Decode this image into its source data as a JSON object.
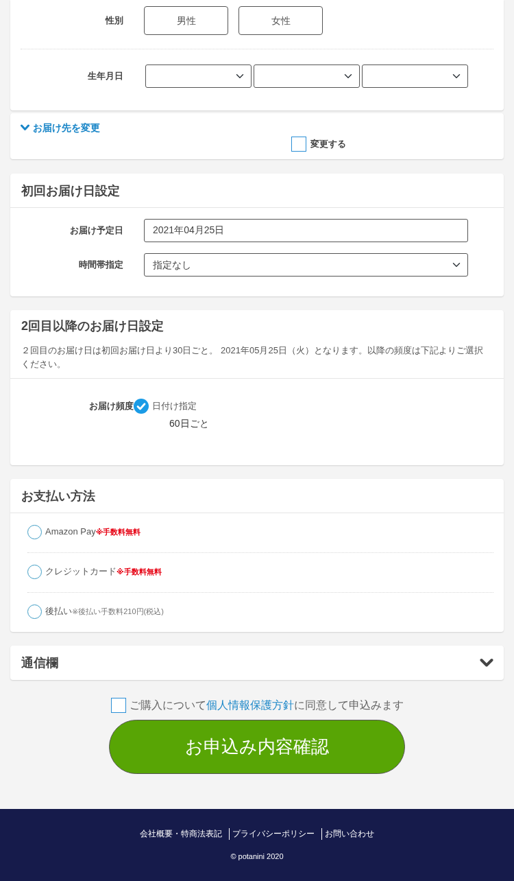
{
  "profile": {
    "fields": [
      {
        "kind": "choice",
        "label": "性別",
        "options": [
          {
            "label": "男性",
            "selected": false
          },
          {
            "label": "女性",
            "selected": false
          }
        ]
      },
      {
        "kind": "date",
        "label": "生年月日"
      }
    ]
  },
  "delivery_address": {
    "toggle_label": "お届け先を変更",
    "expanded": false,
    "checkbox": {
      "label": "変更する",
      "checked": false
    }
  },
  "first_delivery": {
    "title": "初回お届け日設定",
    "fields": [
      {
        "kind": "text",
        "label": "お届け予定日",
        "value": "2021年04月25日"
      },
      {
        "kind": "select",
        "label": "時間帯指定",
        "value": "指定なし"
      }
    ]
  },
  "later_delivery": {
    "title": "2回目以降のお届け日設定",
    "description": "２回目のお届け日は初回お届け日より30日ごと。 2021年05月25日（火）となります。以降の頻度は下記よりご選択ください。",
    "frequency": {
      "label": "お届け頻度",
      "options": [
        {
          "label": "日付け指定",
          "checked": true
        }
      ],
      "value": "60日ごと"
    }
  },
  "payment": {
    "title": "お支払い方法",
    "options": [
      {
        "label": "Amazon Pay",
        "note": "※手数料無料",
        "kind": "highlight",
        "selected": false
      },
      {
        "label": "クレジットカード",
        "note": "※手数料無料",
        "kind": "highlight",
        "selected": false
      },
      {
        "label": "後払い",
        "note": "※後払い手数料210円(税込)",
        "kind": "muted",
        "selected": false
      }
    ]
  },
  "message": {
    "title": "通信欄",
    "expanded": false
  },
  "agreement": {
    "checked": false,
    "text_before": "ご購入について",
    "link": "個人情報保護方針",
    "text_after": "に同意して申込みます"
  },
  "submit_button": {
    "label": "お申込み内容確認"
  },
  "footer": {
    "links": [
      "会社概要・特商法表記",
      "プライバシーポリシー",
      "お問い合わせ"
    ],
    "copyright": "© potanini 2020"
  }
}
